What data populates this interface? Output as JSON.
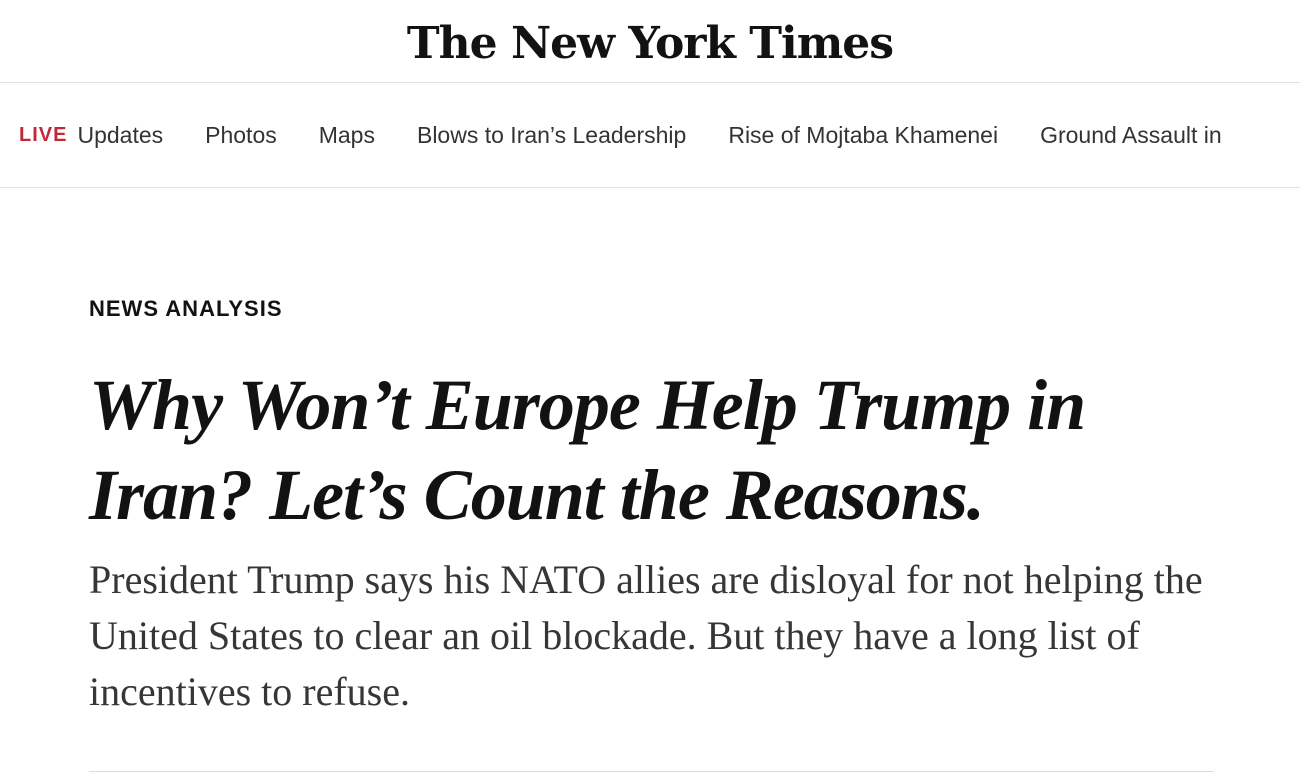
{
  "masthead": {
    "logo_text": "The New York Times"
  },
  "nav": {
    "live_label": "LIVE",
    "items": [
      {
        "label": "Updates"
      },
      {
        "label": "Photos"
      },
      {
        "label": "Maps"
      },
      {
        "label": "Blows to Iran’s Leadership"
      },
      {
        "label": "Rise of Mojtaba Khamenei"
      },
      {
        "label": "Ground Assault in"
      }
    ]
  },
  "article": {
    "kicker": "NEWS ANALYSIS",
    "headline": "Why Won’t Europe Help Trump in Iran? Let’s Count the Reasons.",
    "summary": "President Trump says his NATO allies are disloyal for not helping the United States to clear an oil blockade. But they have a long list of incentives to refuse."
  },
  "colors": {
    "live_accent": "#c3283a",
    "text_primary": "#121212",
    "text_summary": "#363636",
    "divider": "#e2e2e2"
  }
}
